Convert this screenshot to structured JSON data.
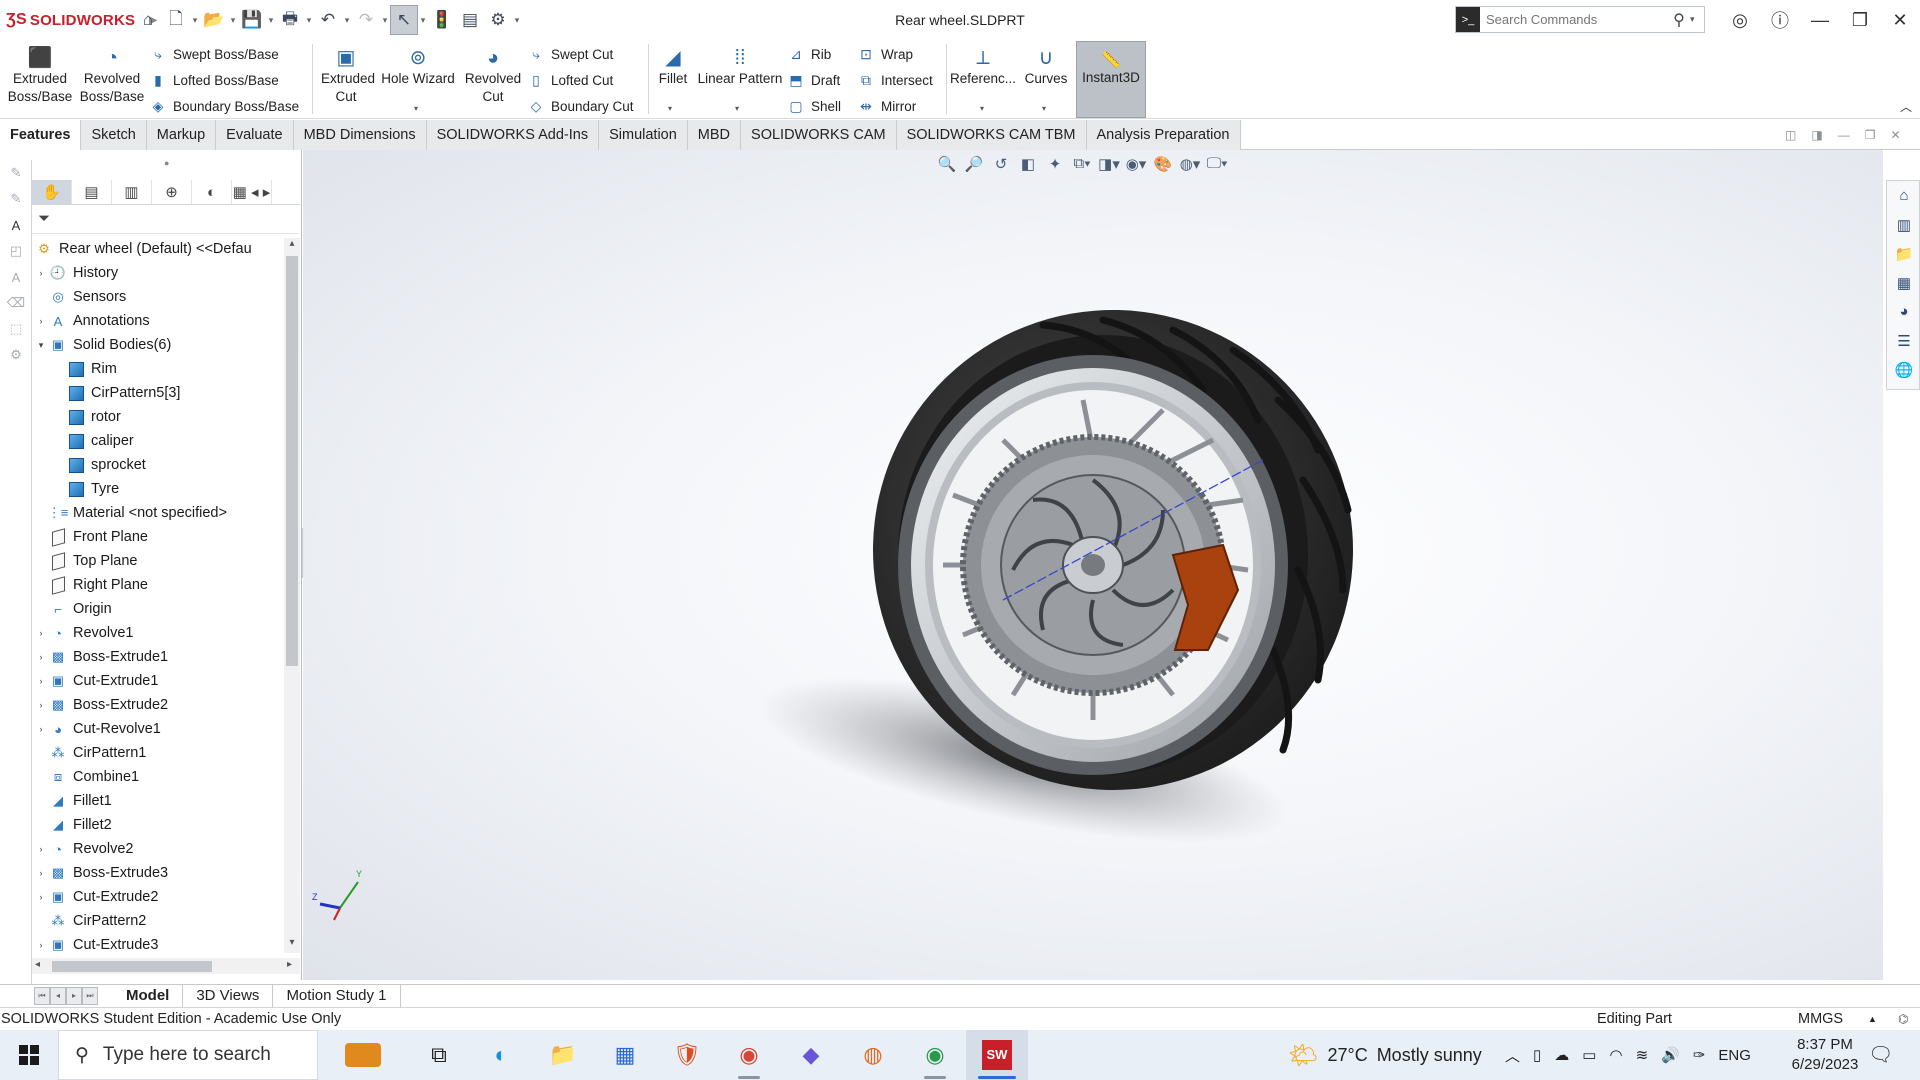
{
  "titlebar": {
    "app_name": "SOLIDWORKS",
    "document_title": "Rear wheel.SLDPRT",
    "search_placeholder": "Search Commands"
  },
  "command_manager": {
    "extruded_boss": "Extruded Boss/Base",
    "revolved_boss": "Revolved Boss/Base",
    "swept_boss": "Swept Boss/Base",
    "lofted_boss": "Lofted Boss/Base",
    "boundary_boss": "Boundary Boss/Base",
    "extruded_cut": "Extruded Cut",
    "hole_wizard": "Hole Wizard",
    "revolved_cut": "Revolved Cut",
    "swept_cut": "Swept Cut",
    "lofted_cut": "Lofted Cut",
    "boundary_cut": "Boundary Cut",
    "fillet": "Fillet",
    "linear_pattern": "Linear Pattern",
    "rib": "Rib",
    "draft": "Draft",
    "shell": "Shell",
    "wrap": "Wrap",
    "intersect": "Intersect",
    "mirror": "Mirror",
    "reference": "Referenc...",
    "curves": "Curves",
    "instant3d": "Instant3D"
  },
  "tabs": [
    "Features",
    "Sketch",
    "Markup",
    "Evaluate",
    "MBD Dimensions",
    "SOLIDWORKS Add-Ins",
    "Simulation",
    "MBD",
    "SOLIDWORKS CAM",
    "SOLIDWORKS CAM TBM",
    "Analysis Preparation"
  ],
  "tree": {
    "root": "Rear wheel (Default) <<Defau",
    "items": [
      {
        "label": "History",
        "icon": "history-icon",
        "indent": 1,
        "expander": true
      },
      {
        "label": "Sensors",
        "icon": "sensors-icon",
        "indent": 1,
        "expander": false
      },
      {
        "label": "Annotations",
        "icon": "annotations-icon",
        "indent": 1,
        "expander": true
      },
      {
        "label": "Solid Bodies(6)",
        "icon": "solid-bodies-folder-icon",
        "indent": 1,
        "expander": "open"
      },
      {
        "label": "Rim",
        "icon": "solid-body-icon",
        "indent": 2,
        "expander": false
      },
      {
        "label": "CirPattern5[3]",
        "icon": "solid-body-icon",
        "indent": 2,
        "expander": false
      },
      {
        "label": "rotor",
        "icon": "solid-body-icon",
        "indent": 2,
        "expander": false
      },
      {
        "label": "caliper",
        "icon": "solid-body-icon",
        "indent": 2,
        "expander": false
      },
      {
        "label": "sprocket",
        "icon": "solid-body-icon",
        "indent": 2,
        "expander": false
      },
      {
        "label": "Tyre",
        "icon": "solid-body-icon",
        "indent": 2,
        "expander": false
      },
      {
        "label": "Material <not specified>",
        "icon": "material-icon",
        "indent": 1,
        "expander": false
      },
      {
        "label": "Front Plane",
        "icon": "plane-icon",
        "indent": 1,
        "expander": false
      },
      {
        "label": "Top Plane",
        "icon": "plane-icon",
        "indent": 1,
        "expander": false
      },
      {
        "label": "Right Plane",
        "icon": "plane-icon",
        "indent": 1,
        "expander": false
      },
      {
        "label": "Origin",
        "icon": "origin-icon",
        "indent": 1,
        "expander": false
      },
      {
        "label": "Revolve1",
        "icon": "revolve-icon",
        "indent": 1,
        "expander": true
      },
      {
        "label": "Boss-Extrude1",
        "icon": "extrude-icon",
        "indent": 1,
        "expander": true
      },
      {
        "label": "Cut-Extrude1",
        "icon": "cut-extrude-icon",
        "indent": 1,
        "expander": true
      },
      {
        "label": "Boss-Extrude2",
        "icon": "extrude-icon",
        "indent": 1,
        "expander": true
      },
      {
        "label": "Cut-Revolve1",
        "icon": "cut-revolve-icon",
        "indent": 1,
        "expander": true
      },
      {
        "label": "CirPattern1",
        "icon": "circular-pattern-icon",
        "indent": 1,
        "expander": false
      },
      {
        "label": "Combine1",
        "icon": "combine-icon",
        "indent": 1,
        "expander": false
      },
      {
        "label": "Fillet1",
        "icon": "fillet-icon",
        "indent": 1,
        "expander": false
      },
      {
        "label": "Fillet2",
        "icon": "fillet-icon",
        "indent": 1,
        "expander": false
      },
      {
        "label": "Revolve2",
        "icon": "revolve-icon",
        "indent": 1,
        "expander": true
      },
      {
        "label": "Boss-Extrude3",
        "icon": "extrude-icon",
        "indent": 1,
        "expander": true
      },
      {
        "label": "Cut-Extrude2",
        "icon": "cut-extrude-icon",
        "indent": 1,
        "expander": true
      },
      {
        "label": "CirPattern2",
        "icon": "circular-pattern-icon",
        "indent": 1,
        "expander": false
      },
      {
        "label": "Cut-Extrude3",
        "icon": "cut-extrude-icon",
        "indent": 1,
        "expander": true
      }
    ]
  },
  "bottom_tabs": [
    "Model",
    "3D Views",
    "Motion Study 1"
  ],
  "status": {
    "edition": "SOLIDWORKS Student Edition - Academic Use Only",
    "mode": "Editing Part",
    "units": "MMGS"
  },
  "taskbar": {
    "search_placeholder": "Type here to search",
    "weather_temp": "27°C",
    "weather_desc": "Mostly sunny",
    "language": "ENG",
    "time": "8:37 PM",
    "date": "6/29/2023"
  },
  "colors": {
    "brand_red": "#c8202a",
    "icon_blue": "#2b6aa8",
    "tyre": "#2f2f2f",
    "caliper": "#a9420f"
  }
}
